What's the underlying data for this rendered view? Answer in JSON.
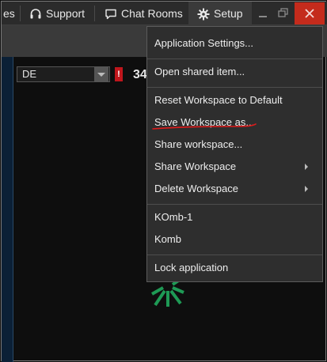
{
  "topbar": {
    "partial_tab": "es",
    "support_label": "Support",
    "chat_rooms_label": "Chat Rooms",
    "setup_label": "Setup"
  },
  "workspace": {
    "symbol_value": "DE",
    "alert_badge": "!",
    "partial_value": "34"
  },
  "setup_menu": {
    "items": [
      {
        "label": "Application Settings..."
      },
      {
        "label": "Open shared item..."
      },
      {
        "label": "Reset Workspace to Default"
      },
      {
        "label": "Save Workspace as..."
      },
      {
        "label": "Share workspace..."
      },
      {
        "label": "Share Workspace",
        "submenu": true
      },
      {
        "label": "Delete Workspace",
        "submenu": true
      },
      {
        "label": "KOmb-1"
      },
      {
        "label": "Komb"
      },
      {
        "label": "Lock application"
      }
    ]
  },
  "colors": {
    "accent_close": "#c42b1c",
    "highlight_underline": "#e01a1a",
    "spinner": "#1e9a55"
  },
  "icons": [
    "headset-icon",
    "chat-icon",
    "gear-icon",
    "minimize-icon",
    "restore-icon",
    "close-icon",
    "dropdown-arrow-icon",
    "loading-spinner-icon"
  ]
}
